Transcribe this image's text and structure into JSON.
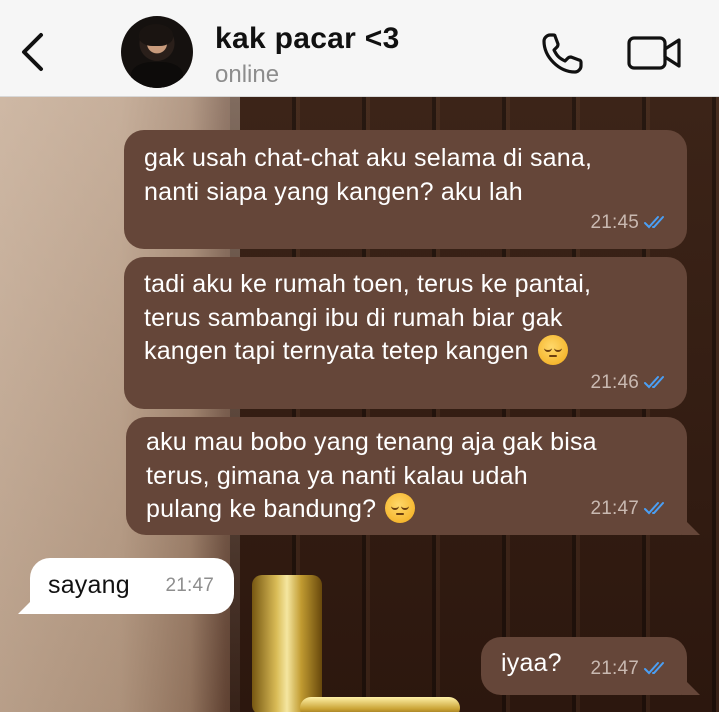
{
  "header": {
    "contact_name": "kak pacar <3",
    "status": "online",
    "icons": {
      "back": "chevron-left-icon",
      "call": "phone-icon",
      "video": "video-camera-icon"
    }
  },
  "colors": {
    "outgoing_bubble": "#654639",
    "incoming_bubble": "#ffffff",
    "read_tick": "#4a9ff5"
  },
  "messages": [
    {
      "direction": "outgoing",
      "lines": [
        "gak usah chat-chat aku selama di sana,",
        "nanti siapa yang kangen? aku lah"
      ],
      "time": "21:45",
      "status": "read"
    },
    {
      "direction": "outgoing",
      "lines": [
        "tadi aku ke rumah toen, terus ke pantai,",
        "terus sambangi ibu di rumah biar gak",
        "kangen tapi ternyata tetep kangen"
      ],
      "emoji": "pensive-face",
      "time": "21:46",
      "status": "read"
    },
    {
      "direction": "outgoing",
      "lines": [
        "aku mau bobo yang tenang aja gak bisa",
        "terus, gimana ya nanti kalau udah",
        "pulang ke bandung?"
      ],
      "emoji": "pensive-face",
      "time": "21:47",
      "status": "read"
    },
    {
      "direction": "incoming",
      "lines": [
        "sayang"
      ],
      "time": "21:47"
    },
    {
      "direction": "outgoing",
      "lines": [
        "iyaa?"
      ],
      "time": "21:47",
      "status": "read"
    }
  ]
}
